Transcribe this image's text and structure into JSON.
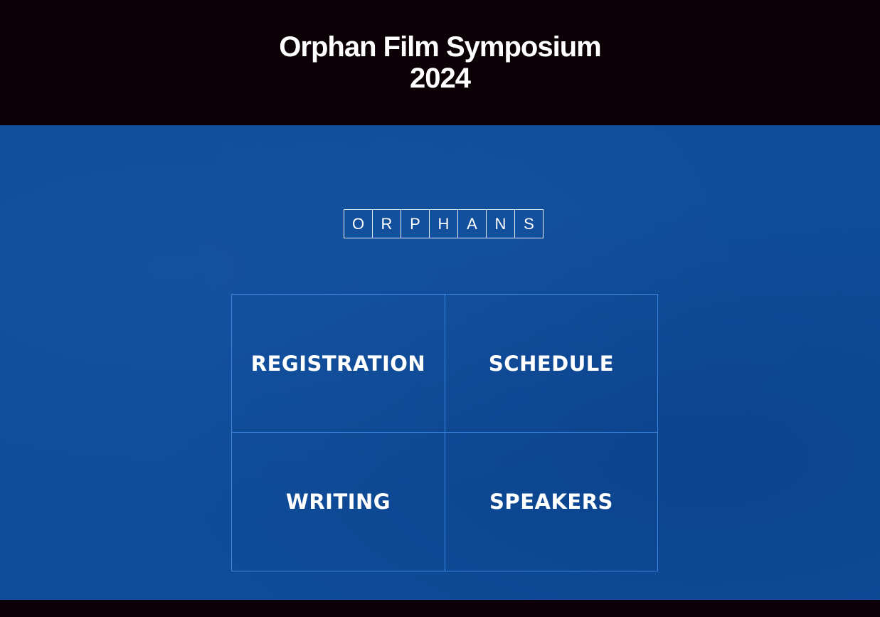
{
  "header": {
    "title_line1": "Orphan Film Symposium",
    "title_line2": "2024"
  },
  "logo": {
    "letters": [
      "O",
      "R",
      "P",
      "H",
      "A",
      "N",
      "S"
    ]
  },
  "nav": {
    "items": [
      {
        "label": "REGISTRATION"
      },
      {
        "label": "SCHEDULE"
      },
      {
        "label": "WRITING"
      },
      {
        "label": "SPEAKERS"
      }
    ]
  },
  "colors": {
    "header_bg": "#0b0006",
    "hero_bg": "#0e4c98",
    "grid_border": "#3d86df",
    "text": "#ffffff"
  }
}
